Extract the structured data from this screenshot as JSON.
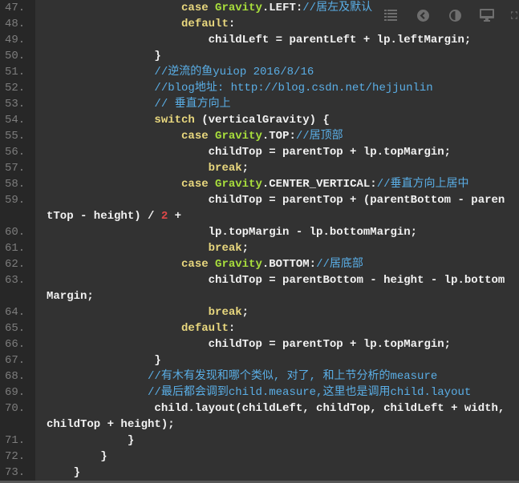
{
  "toolbar": {
    "icons": [
      "list-icon",
      "back-icon",
      "contrast-icon",
      "monitor-icon",
      "fullscreen-icon"
    ]
  },
  "colors": {
    "keyword": "#e8d77e",
    "class": "#a8de3c",
    "comment": "#5aaee6",
    "number": "#e04848",
    "text": "#f2f2f2",
    "gutter_bg": "#272727",
    "code_bg": "#323232"
  },
  "lines": [
    {
      "num": "47.",
      "tokens": [
        [
          "t",
          "                    "
        ],
        [
          "k",
          "case"
        ],
        [
          "t",
          " "
        ],
        [
          "c",
          "Gravity"
        ],
        [
          "t",
          ".LEFT:"
        ],
        [
          "m",
          "//居左及默认"
        ]
      ]
    },
    {
      "num": "48.",
      "tokens": [
        [
          "t",
          "                    "
        ],
        [
          "k",
          "default"
        ],
        [
          "t",
          ":"
        ]
      ]
    },
    {
      "num": "49.",
      "tokens": [
        [
          "t",
          "                        childLeft = parentLeft + lp.leftMargin;"
        ]
      ]
    },
    {
      "num": "50.",
      "tokens": [
        [
          "t",
          "                }"
        ]
      ]
    },
    {
      "num": "51.",
      "tokens": [
        [
          "t",
          "                "
        ],
        [
          "m",
          "//逆流的鱼yuiop 2016/8/16"
        ]
      ]
    },
    {
      "num": "52.",
      "tokens": [
        [
          "t",
          "                "
        ],
        [
          "m",
          "//blog地址: http://blog.csdn.net/hejjunlin"
        ]
      ]
    },
    {
      "num": "53.",
      "tokens": [
        [
          "t",
          "                "
        ],
        [
          "m",
          "// 垂直方向上"
        ]
      ]
    },
    {
      "num": "54.",
      "tokens": [
        [
          "t",
          "                "
        ],
        [
          "k",
          "switch"
        ],
        [
          "t",
          " (verticalGravity) {"
        ]
      ]
    },
    {
      "num": "55.",
      "tokens": [
        [
          "t",
          "                    "
        ],
        [
          "k",
          "case"
        ],
        [
          "t",
          " "
        ],
        [
          "c",
          "Gravity"
        ],
        [
          "t",
          ".TOP:"
        ],
        [
          "m",
          "//居顶部"
        ]
      ]
    },
    {
      "num": "56.",
      "tokens": [
        [
          "t",
          "                        childTop = parentTop + lp.topMargin;"
        ]
      ]
    },
    {
      "num": "57.",
      "tokens": [
        [
          "t",
          "                        "
        ],
        [
          "k",
          "break"
        ],
        [
          "t",
          ";"
        ]
      ]
    },
    {
      "num": "58.",
      "tokens": [
        [
          "t",
          "                    "
        ],
        [
          "k",
          "case"
        ],
        [
          "t",
          " "
        ],
        [
          "c",
          "Gravity"
        ],
        [
          "t",
          ".CENTER_VERTICAL:"
        ],
        [
          "m",
          "//垂直方向上居中"
        ]
      ]
    },
    {
      "num": "59.",
      "tokens": [
        [
          "t",
          "                        childTop = parentTop + (parentBottom - paren"
        ]
      ]
    },
    {
      "num": "",
      "tokens": [
        [
          "t",
          "tTop - height) / "
        ],
        [
          "n",
          "2"
        ],
        [
          "t",
          " +"
        ]
      ]
    },
    {
      "num": "60.",
      "tokens": [
        [
          "t",
          "                        lp.topMargin - lp.bottomMargin;"
        ]
      ]
    },
    {
      "num": "61.",
      "tokens": [
        [
          "t",
          "                        "
        ],
        [
          "k",
          "break"
        ],
        [
          "t",
          ";"
        ]
      ]
    },
    {
      "num": "62.",
      "tokens": [
        [
          "t",
          "                    "
        ],
        [
          "k",
          "case"
        ],
        [
          "t",
          " "
        ],
        [
          "c",
          "Gravity"
        ],
        [
          "t",
          ".BOTTOM:"
        ],
        [
          "m",
          "//居底部"
        ]
      ]
    },
    {
      "num": "63.",
      "tokens": [
        [
          "t",
          "                        childTop = parentBottom - height - lp.bottom"
        ]
      ]
    },
    {
      "num": "",
      "tokens": [
        [
          "t",
          "Margin;"
        ]
      ]
    },
    {
      "num": "64.",
      "tokens": [
        [
          "t",
          "                        "
        ],
        [
          "k",
          "break"
        ],
        [
          "t",
          ";"
        ]
      ]
    },
    {
      "num": "65.",
      "tokens": [
        [
          "t",
          "                    "
        ],
        [
          "k",
          "default"
        ],
        [
          "t",
          ":"
        ]
      ]
    },
    {
      "num": "66.",
      "tokens": [
        [
          "t",
          "                        childTop = parentTop + lp.topMargin;"
        ]
      ]
    },
    {
      "num": "67.",
      "tokens": [
        [
          "t",
          "                }"
        ]
      ]
    },
    {
      "num": "68.",
      "tokens": [
        [
          "t",
          "               "
        ],
        [
          "m",
          "//有木有发现和哪个类似, 对了, 和上节分析的measure"
        ]
      ]
    },
    {
      "num": "69.",
      "tokens": [
        [
          "t",
          "               "
        ],
        [
          "m",
          "//最后都会调到child.measure,这里也是调用child.layout"
        ]
      ]
    },
    {
      "num": "70.",
      "tokens": [
        [
          "t",
          "                child.layout(childLeft, childTop, childLeft + width,"
        ]
      ]
    },
    {
      "num": "",
      "tokens": [
        [
          "t",
          "childTop + height);"
        ]
      ]
    },
    {
      "num": "71.",
      "tokens": [
        [
          "t",
          "            }"
        ]
      ]
    },
    {
      "num": "72.",
      "tokens": [
        [
          "t",
          "        }"
        ]
      ]
    },
    {
      "num": "73.",
      "tokens": [
        [
          "t",
          "    }"
        ]
      ]
    }
  ]
}
